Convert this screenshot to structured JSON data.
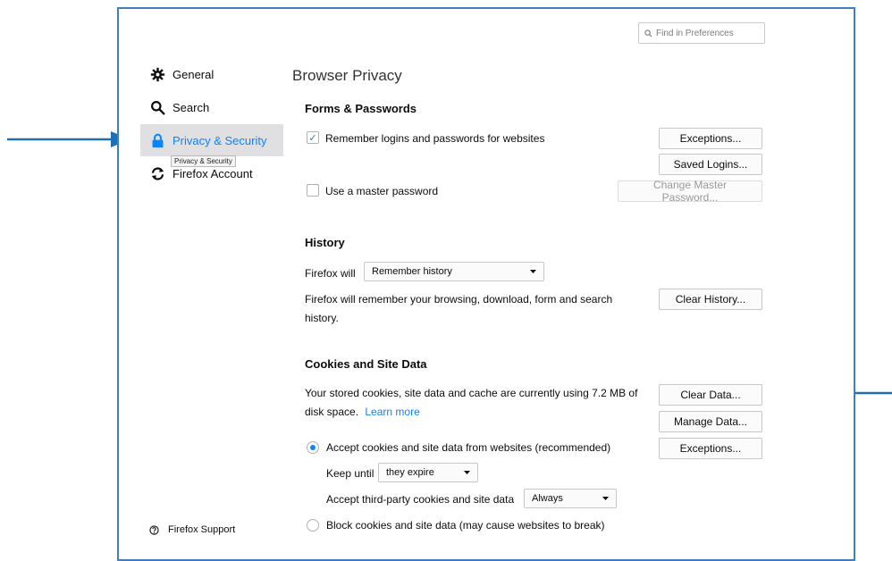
{
  "search": {
    "placeholder": "Find in Preferences"
  },
  "sidebar": {
    "items": [
      {
        "label": "General"
      },
      {
        "label": "Search"
      },
      {
        "label": "Privacy & Security"
      },
      {
        "label": "Firefox Account"
      }
    ],
    "tooltip": "Privacy & Security",
    "support": "Firefox Support"
  },
  "main": {
    "title": "Browser Privacy",
    "forms": {
      "title": "Forms & Passwords",
      "remember_logins": "Remember logins and passwords for websites",
      "exceptions": "Exceptions...",
      "saved_logins": "Saved Logins...",
      "master_password": "Use a master password",
      "change_master": "Change Master Password..."
    },
    "history": {
      "title": "History",
      "firefox_will": "Firefox will",
      "mode": "Remember history",
      "desc_line1": "Firefox will remember your browsing, download, form and search",
      "desc_line2": "history.",
      "clear": "Clear History..."
    },
    "cookies": {
      "title": "Cookies and Site Data",
      "desc_line1": "Your stored cookies, site data and cache are currently using 7.2 MB of",
      "desc_line2": "disk space.",
      "learn_more": "Learn more",
      "clear_data": "Clear Data...",
      "manage_data": "Manage Data...",
      "exceptions": "Exceptions...",
      "accept": "Accept cookies and site data from websites (recommended)",
      "keep_until": "Keep until",
      "keep_value": "they expire",
      "third_party": "Accept third-party cookies and site data",
      "third_party_value": "Always",
      "block": "Block cookies and site data (may cause websites to break)"
    }
  },
  "colors": {
    "accent": "#0a84ff",
    "annotation": "#1f6fb5",
    "window_border": "#3f7ec0"
  }
}
